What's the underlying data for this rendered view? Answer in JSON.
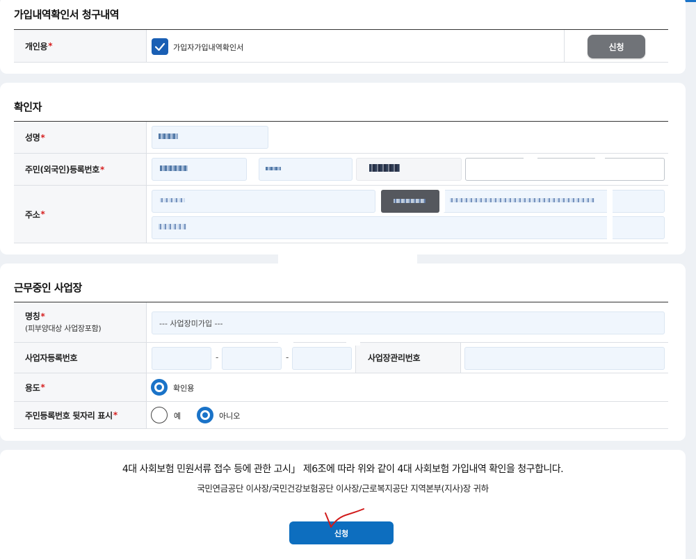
{
  "section1": {
    "title": "가입내역확인서 청구내역",
    "row_label": "개인용",
    "required": "*",
    "checkbox_label": "가입자가입내역확인서",
    "checkbox_checked": true,
    "apply_label": "신청"
  },
  "section2": {
    "title": "확인자",
    "name_label": "성명",
    "rrn_label": "주민(외국인)등록번호",
    "address_label": "주소",
    "required": "*"
  },
  "section3": {
    "title": "근무중인 사업장",
    "company_label": "명칭",
    "company_sub": "(피부양대상 사업장포함)",
    "company_value": "--- 사업장미가입 ---",
    "bizno_label": "사업자등록번호",
    "bizno_sep": "-",
    "mgmt_label": "사업장관리번호",
    "purpose_label": "용도",
    "purpose_option": "확인용",
    "suffix_label": "주민등록번호 뒷자리 표시",
    "suffix_yes": "예",
    "suffix_no": "아니오",
    "required": "*"
  },
  "notice": {
    "line1": "4대 사회보험 민원서류 접수 등에 관한 고시」 제6조에 따라 위와 같이 4대 사회보험 가입내역 확인을 청구합니다.",
    "line2": "국민연금공단 이사장/국민건강보험공단 이사장/근로복지공단 지역본부(지사)장 귀하",
    "submit_label": "신청"
  },
  "colors": {
    "accent": "#1a73c8",
    "required": "#d62020",
    "submit": "#0d6ebf",
    "annotation": "#d11a1a"
  }
}
